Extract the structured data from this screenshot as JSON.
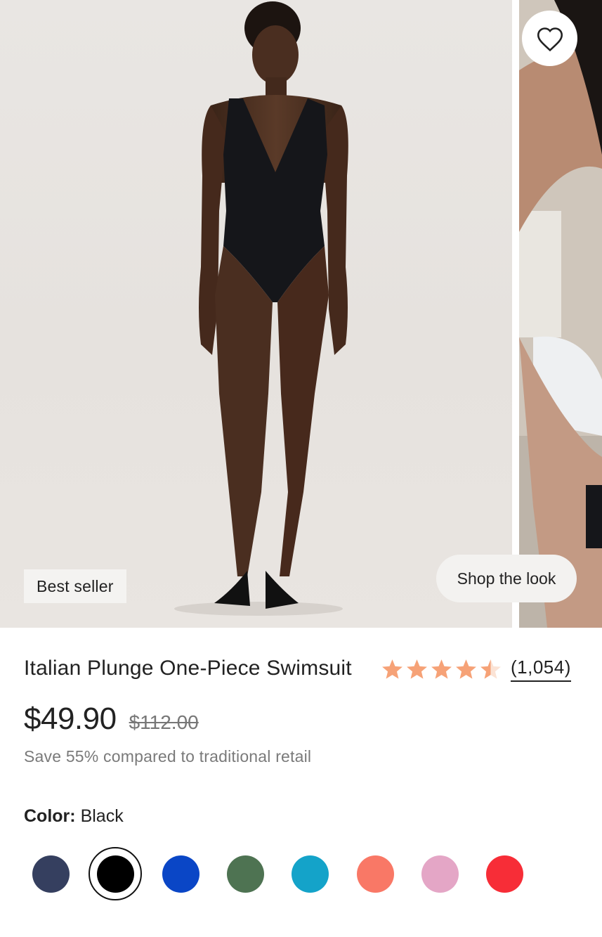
{
  "gallery": {
    "badge": "Best seller",
    "shop_the_look": "Shop the look",
    "wishlist_icon": "heart-outline-icon"
  },
  "product": {
    "title": "Italian Plunge One-Piece Swimsuit",
    "rating": 4.5,
    "review_count": "(1,054)",
    "price_now": "$49.90",
    "price_was": "$112.00",
    "savings_note": "Save 55% compared to traditional retail"
  },
  "color": {
    "label": "Color:",
    "selected": "Black",
    "swatches": [
      {
        "name": "navy",
        "hex": "#353f5f"
      },
      {
        "name": "black",
        "hex": "#000000",
        "selected": true
      },
      {
        "name": "royal-blue",
        "hex": "#0a46c6"
      },
      {
        "name": "green",
        "hex": "#4e7352"
      },
      {
        "name": "turquoise",
        "hex": "#14a3c9"
      },
      {
        "name": "coral",
        "hex": "#f97866"
      },
      {
        "name": "pink",
        "hex": "#e4a6c6"
      },
      {
        "name": "red",
        "hex": "#f72d37"
      }
    ]
  },
  "colors": {
    "star": "#f6a277",
    "text": "#222222",
    "muted": "#7a7a7a"
  }
}
